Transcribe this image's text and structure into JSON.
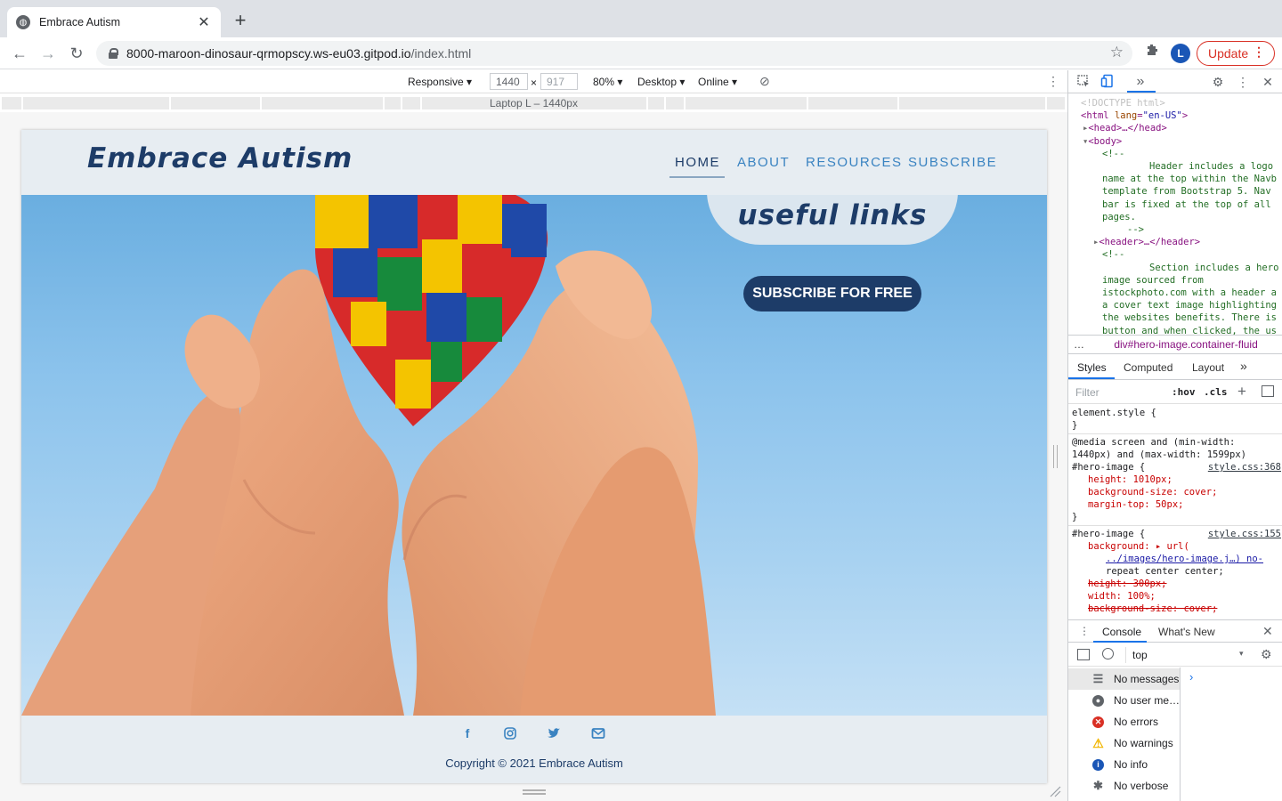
{
  "browser": {
    "tab_title": "Embrace Autism",
    "tab_close": "✕",
    "new_tab": "+",
    "url_host": "8000-maroon-dinosaur-qrmopscy.ws-eu03.gitpod.io",
    "url_path": "/index.html",
    "avatar_initial": "L",
    "update_label": "Update"
  },
  "device_toolbar": {
    "mode": "Responsive",
    "width": "1440",
    "height": "917",
    "zoom": "80%",
    "device_type": "Desktop",
    "throttle": "Online",
    "breakpoint_label": "Laptop L – 1440px"
  },
  "site": {
    "logo": "Embrace Autism",
    "nav": [
      "HOME",
      "ABOUT",
      "RESOURCES",
      "SUBSCRIBE"
    ],
    "hero_cover_text": "useful links",
    "hero_button": "SUBSCRIBE FOR FREE",
    "copyright": "Copyright © 2021 Embrace Autism",
    "social": [
      "facebook-icon",
      "instagram-icon",
      "twitter-icon",
      "email-icon"
    ]
  },
  "devtools": {
    "dom_lines": {
      "doctype": "<!DOCTYPE html>",
      "html_open": "<html lang=\"en-US\">",
      "head": "<head>…</head>",
      "body": "<body>",
      "comment_open": "<!--",
      "comment1_l1": "Header includes a logo",
      "comment1_l2": "name at the top within the Navb",
      "comment1_l3": "template from Bootstrap 5. Nav",
      "comment1_l4": "bar is fixed at the top of all",
      "comment1_l5": "pages.",
      "comment_close": "-->",
      "header": "<header>…</header>",
      "comment2_open": "<!--",
      "comment2_l1": "Section includes a hero",
      "comment2_l2": "image sourced from",
      "comment2_l3": "istockphoto.com with a header a",
      "comment2_l4": "a cover text image highlighting",
      "comment2_l5": "the websites benefits. There is",
      "comment2_l6": "button and when clicked, the us"
    },
    "breadcrumb": "div#hero-image.container-fluid",
    "style_tabs": [
      "Styles",
      "Computed",
      "Layout"
    ],
    "filter_placeholder": "Filter",
    "hov": ":hov",
    "cls": ".cls",
    "styles": {
      "element_style": "element.style {",
      "close_brace": "}",
      "media_l1": "@media screen and (min-width:",
      "media_l2": "1440px) and (max-width: 1599px)",
      "rule1_selector": "#hero-image {",
      "rule1_src": "style.css:368",
      "rule1_p1": "height: 1010px;",
      "rule1_p2": "background-size: cover;",
      "rule1_p3": "margin-top: 50px;",
      "rule2_selector": "#hero-image {",
      "rule2_src": "style.css:155",
      "rule2_p1": "background: ▸ url(",
      "rule2_p1b": "../images/hero-image.j…) no-",
      "rule2_p1c": "repeat center center;",
      "rule2_p2": "height: 300px;",
      "rule2_p3": "width: 100%;",
      "rule2_p4": "background-size: cover;"
    },
    "drawer_tabs": [
      "Console",
      "What's New"
    ],
    "context": "top",
    "sidebar": [
      "No messages",
      "No user me…",
      "No errors",
      "No warnings",
      "No info",
      "No verbose"
    ]
  }
}
